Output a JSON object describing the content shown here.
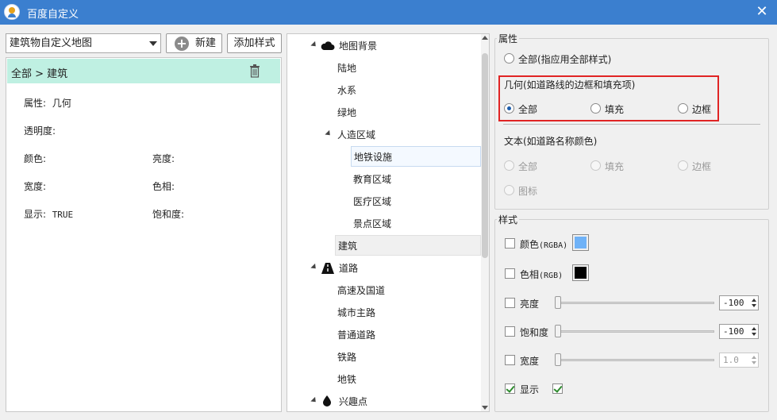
{
  "window": {
    "title": "百度自定义",
    "close_glyph": "✕"
  },
  "toolbar": {
    "map_combo_value": "建筑物自定义地图",
    "new_button_label": "新建",
    "add_style_label": "添加样式"
  },
  "left_panel": {
    "breadcrumb": "全部 > 建筑",
    "props": {
      "attribute_label": "属性:",
      "attribute_value": "几何",
      "opacity_label": "透明度:",
      "color_label": "颜色:",
      "brightness_label": "亮度:",
      "width_label": "宽度:",
      "hue_label": "色相:",
      "visible_label": "显示:",
      "visible_value": "TRUE",
      "saturation_label": "饱和度:"
    }
  },
  "tree": {
    "items": [
      {
        "label": "地图背景",
        "icon": "cloud-icon"
      },
      {
        "label": "陆地"
      },
      {
        "label": "水系"
      },
      {
        "label": "绿地"
      },
      {
        "label": "人造区域"
      },
      {
        "label": "地铁设施"
      },
      {
        "label": "教育区域"
      },
      {
        "label": "医疗区域"
      },
      {
        "label": "景点区域"
      },
      {
        "label": "建筑"
      },
      {
        "label": "道路",
        "icon": "road-icon"
      },
      {
        "label": "高速及国道"
      },
      {
        "label": "城市主路"
      },
      {
        "label": "普通道路"
      },
      {
        "label": "铁路"
      },
      {
        "label": "地铁"
      },
      {
        "label": "兴趣点",
        "icon": "drop-icon"
      }
    ]
  },
  "properties": {
    "group_title": "属性",
    "all_apply_label": "全部(指应用全部样式)",
    "geometry_title": "几何(如道路线的边框和填充项)",
    "geometry_options": [
      "全部",
      "填充",
      "边框"
    ],
    "text_title": "文本(如道路名称颜色)",
    "text_options": [
      "全部",
      "填充",
      "边框",
      "图标"
    ]
  },
  "style": {
    "group_title": "样式",
    "color_label": "颜色",
    "color_unit": "(RGBA)",
    "color_swatch": "#6fb2f7",
    "hue_label": "色相",
    "hue_unit": "(RGB)",
    "hue_swatch": "#000000",
    "brightness_label": "亮度",
    "brightness_value": "-100",
    "saturation_label": "饱和度",
    "saturation_value": "-100",
    "width_label": "宽度",
    "width_value": "1.0",
    "visible_label": "显示"
  }
}
